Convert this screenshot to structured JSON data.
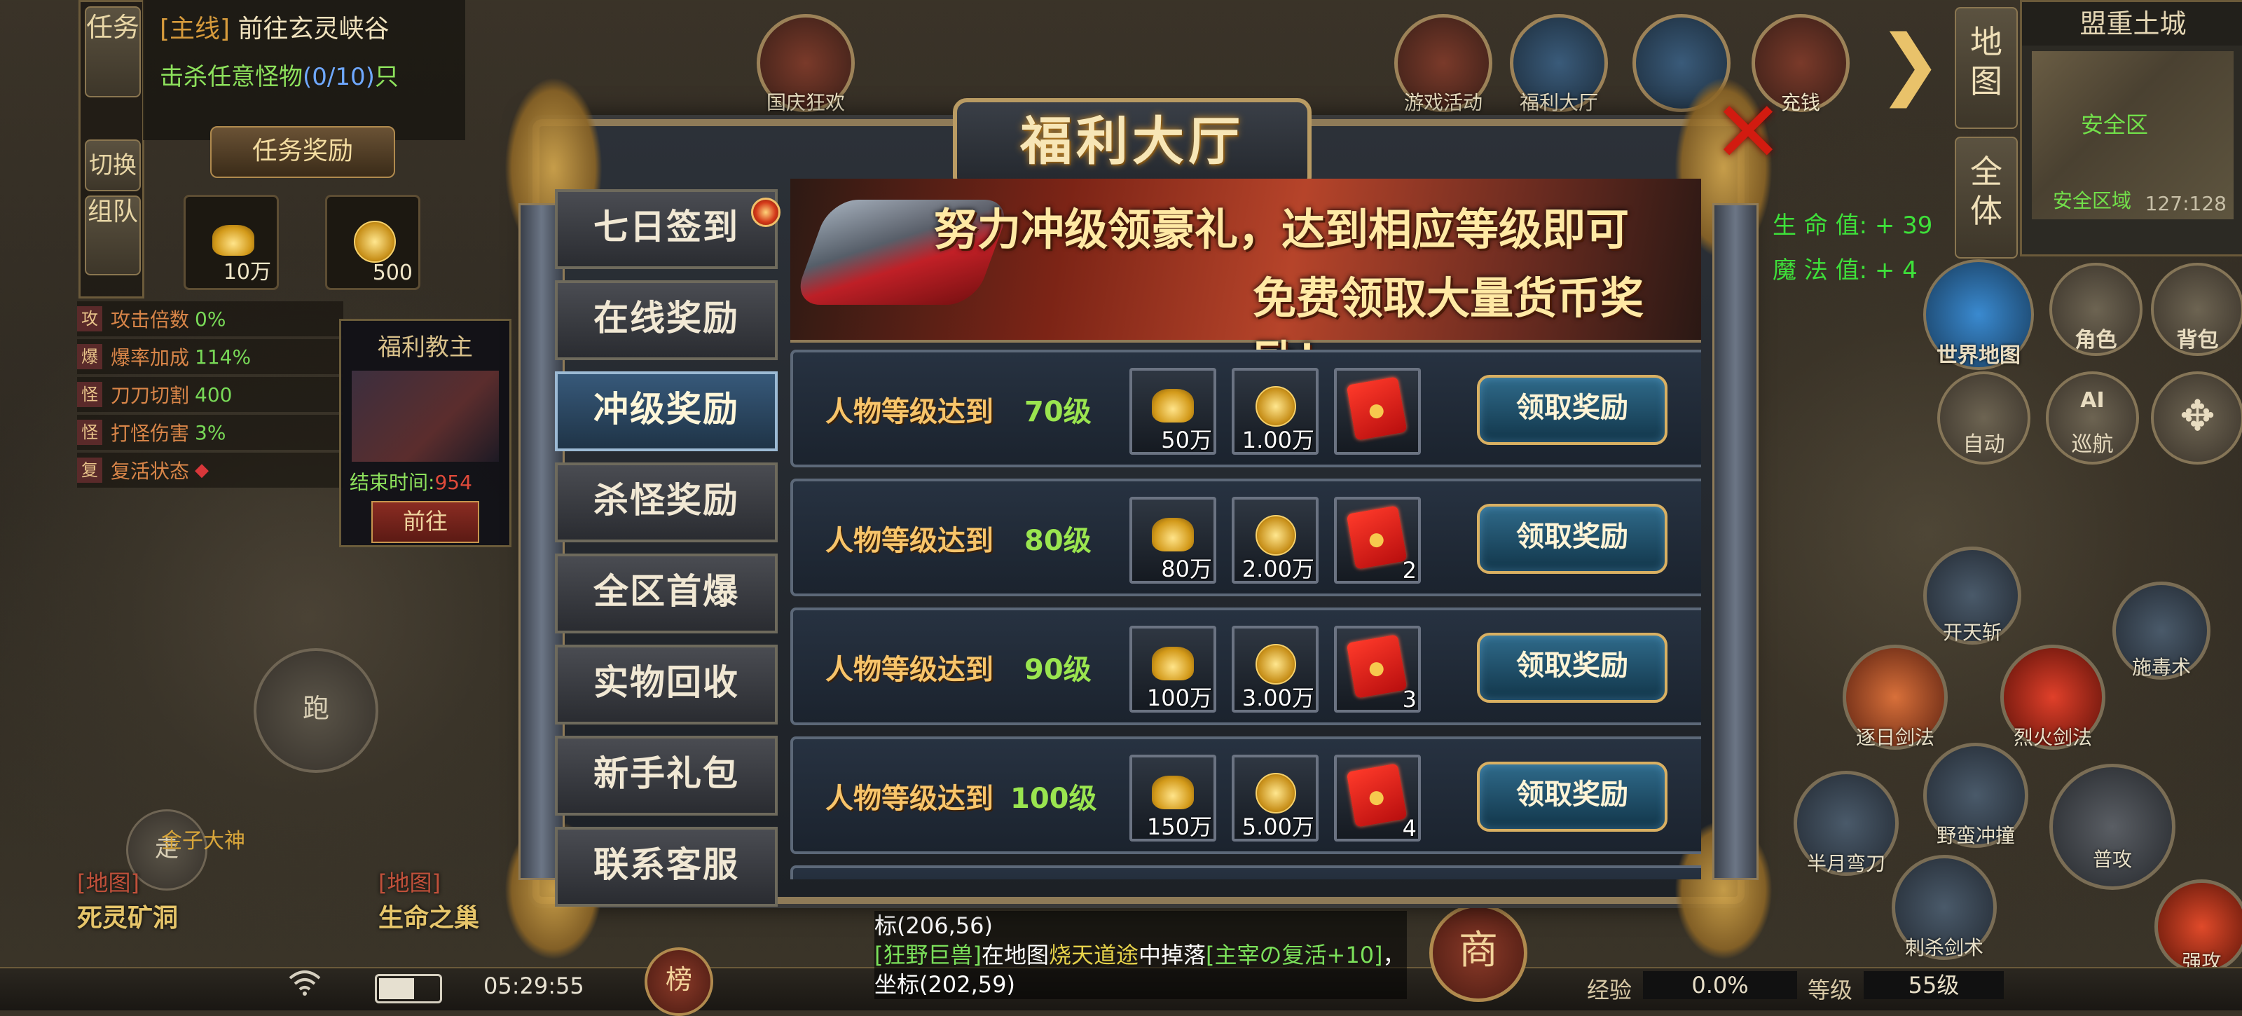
{
  "quest": {
    "side_buttons": [
      "任务",
      "切换",
      "组队"
    ],
    "tag": "[主线]",
    "title": "前往玄灵峡谷",
    "kill_prefix": "击杀任意怪物",
    "kill_progress": "(0/10)",
    "kill_suffix": "只",
    "reward_button": "任务奖励",
    "rewards": [
      {
        "qty": "10万",
        "icon": "gold-ingot-icon"
      },
      {
        "qty": "500",
        "icon": "gold-coin-icon"
      }
    ]
  },
  "stats": [
    {
      "key": "攻",
      "name": "攻击倍数",
      "value": "0%"
    },
    {
      "key": "爆",
      "name": "爆率加成",
      "value": "114%"
    },
    {
      "key": "怪",
      "name": "刀刀切割",
      "value": "400"
    },
    {
      "key": "怪",
      "name": "打怪伤害",
      "value": "3%"
    },
    {
      "key": "复",
      "name": "复活状态",
      "value": ""
    }
  ],
  "boss": {
    "title": "福利教主",
    "time_label": "结束时间:",
    "time_value": "954",
    "go_button": "前往"
  },
  "controls": {
    "run": "跑",
    "walk": "走",
    "npc_name": "金子大神"
  },
  "maps_left": [
    {
      "tag": "[地图]",
      "name": "死灵矿洞"
    },
    {
      "tag": "[地图]",
      "name": "生命之巢"
    }
  ],
  "top_icons": [
    {
      "label": "国庆狂欢",
      "icon": "lantern-icon"
    },
    {
      "label": "游戏活动",
      "icon": "event-icon"
    },
    {
      "label": "福利大厅",
      "icon": "welfare-hall-icon"
    },
    {
      "label": "",
      "icon": "pavilion-icon"
    },
    {
      "label": "充钱",
      "icon": "treasure-chest-icon"
    }
  ],
  "minimap": {
    "title": "盟重土城",
    "safe_zone": "安全区",
    "safe_area": "安全区域",
    "coord": "127:128",
    "btn_map": "地图",
    "btn_all": "全体"
  },
  "bonus": {
    "hp": "生 命 值: + 39",
    "mp": "魔 法 值: + 4"
  },
  "right_buttons": [
    {
      "label": "世界地图",
      "icon": "world-map-icon"
    },
    {
      "label": "角色",
      "icon": "character-icon"
    },
    {
      "label": "背包",
      "icon": "bag-icon"
    },
    {
      "label": "自动",
      "icon": "auto-icon"
    },
    {
      "label": "巡航",
      "icon": "ai-cruise-icon"
    }
  ],
  "skills": [
    {
      "label": "开天斩"
    },
    {
      "label": "施毒术"
    },
    {
      "label": "逐日剑法"
    },
    {
      "label": "烈火剑法"
    },
    {
      "label": "半月弯刀"
    },
    {
      "label": "野蛮冲撞"
    },
    {
      "label": "普攻"
    },
    {
      "label": "刺杀剑术"
    },
    {
      "label": "强攻"
    }
  ],
  "chat": {
    "line0": "标(206,56)",
    "p1": "[狂野巨兽]",
    "p2": "在地图",
    "p3": "烧天道途",
    "p4": "中掉落",
    "p5": "[主宰の复活+10]",
    "p6": "，坐标(202,59)"
  },
  "bottom": {
    "clock": "05:29:55",
    "rank": "榜",
    "shop": "商",
    "exp_label": "经验",
    "exp_value": "0.0%",
    "level_label": "等级",
    "level_value": "55级",
    "battery_level": 0.6
  },
  "dialog": {
    "title": "福利大厅",
    "tabs": [
      "七日签到",
      "在线奖励",
      "冲级奖励",
      "杀怪奖励",
      "全区首爆",
      "实物回收",
      "新手礼包",
      "联系客服"
    ],
    "active_tab": 2,
    "banner_line1": "努力冲级领豪礼，达到相应等级即可",
    "banner_line2": "免费领取大量货币奖励！",
    "rows": [
      {
        "label": "人物等级达到",
        "level": "70级",
        "items": [
          {
            "qty": "50万"
          },
          {
            "qty": "1.00万"
          },
          {
            "qty": ""
          }
        ],
        "button": "领取奖励"
      },
      {
        "label": "人物等级达到",
        "level": "80级",
        "items": [
          {
            "qty": "80万"
          },
          {
            "qty": "2.00万"
          },
          {
            "qty": "2"
          }
        ],
        "button": "领取奖励"
      },
      {
        "label": "人物等级达到",
        "level": "90级",
        "items": [
          {
            "qty": "100万"
          },
          {
            "qty": "3.00万"
          },
          {
            "qty": "3"
          }
        ],
        "button": "领取奖励"
      },
      {
        "label": "人物等级达到",
        "level": "100级",
        "items": [
          {
            "qty": "150万"
          },
          {
            "qty": "5.00万"
          },
          {
            "qty": "4"
          }
        ],
        "button": "领取奖励"
      }
    ]
  }
}
